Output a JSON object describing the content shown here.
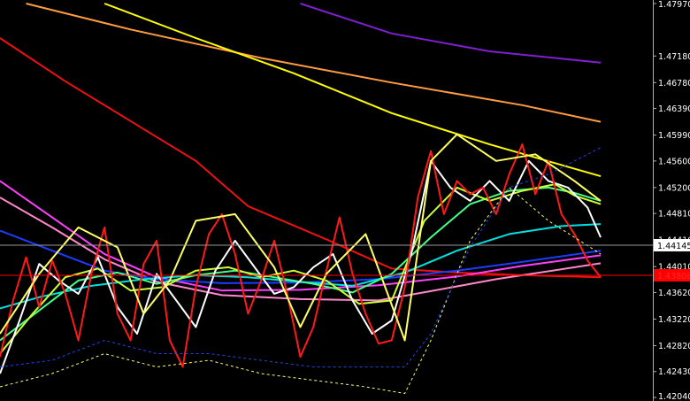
{
  "chart_data": {
    "type": "line",
    "ylim": [
      1.4204,
      1.4797
    ],
    "xlim": [
      0,
      100
    ],
    "grid": false,
    "y_ticks": [
      "1.47970",
      "1.47180",
      "1.46780",
      "1.46390",
      "1.45990",
      "1.45600",
      "1.45200",
      "1.44810",
      "1.44410",
      "1.44010",
      "1.43620",
      "1.43220",
      "1.42820",
      "1.42430",
      "1.42040"
    ],
    "current_price_label": "1.44145",
    "low_price_label": "1.43808",
    "current_price": 1.44145,
    "low_price": 1.43808,
    "colors": {
      "background": "#000000",
      "axis": "#b0b0b0",
      "price_line": "#c0c0c0",
      "low_line": "#ff0000"
    },
    "series": [
      {
        "color": "#7f1fd0",
        "x": [
          46,
          60,
          75,
          92
        ],
        "y": [
          1.4797,
          1.4752,
          1.4725,
          1.4708
        ]
      },
      {
        "color": "#ff9c40",
        "x": [
          4,
          20,
          40,
          60,
          80,
          92
        ],
        "y": [
          1.4797,
          1.4758,
          1.4715,
          1.4678,
          1.4644,
          1.4619
        ]
      },
      {
        "color": "#ffff00",
        "x": [
          16,
          30,
          45,
          60,
          75,
          92
        ],
        "y": [
          1.4797,
          1.4745,
          1.4692,
          1.4632,
          1.4585,
          1.4537
        ]
      },
      {
        "color": "#ee1111",
        "x": [
          0,
          10,
          20,
          30,
          38,
          50,
          60,
          70,
          80,
          92
        ],
        "y": [
          1.4745,
          1.468,
          1.462,
          1.456,
          1.4492,
          1.4442,
          1.4398,
          1.4392,
          1.4388,
          1.4385
        ]
      },
      {
        "color": "#ff40ff",
        "x": [
          0,
          8,
          16,
          24,
          34,
          46,
          58,
          70,
          80,
          92
        ],
        "y": [
          1.453,
          1.4475,
          1.442,
          1.4385,
          1.4365,
          1.4366,
          1.4373,
          1.4386,
          1.4402,
          1.4418
        ]
      },
      {
        "color": "#ff88cc",
        "x": [
          0,
          8,
          16,
          24,
          34,
          46,
          58,
          66,
          76,
          92
        ],
        "y": [
          1.4505,
          1.446,
          1.4412,
          1.4378,
          1.4358,
          1.4352,
          1.435,
          1.4364,
          1.4382,
          1.4406
        ]
      },
      {
        "color": "#1c3cff",
        "x": [
          0,
          8,
          16,
          24,
          34,
          46,
          58,
          70,
          80,
          92
        ],
        "y": [
          1.4455,
          1.4425,
          1.4395,
          1.4382,
          1.4376,
          1.4377,
          1.4382,
          1.4395,
          1.4408,
          1.4425
        ]
      },
      {
        "color": "#00e0e0",
        "x": [
          0,
          6,
          14,
          22,
          30,
          38,
          46,
          54,
          62,
          70,
          78,
          86,
          92
        ],
        "y": [
          1.4338,
          1.4355,
          1.4372,
          1.4382,
          1.4388,
          1.4385,
          1.4378,
          1.4372,
          1.4392,
          1.4425,
          1.445,
          1.4462,
          1.4465
        ]
      },
      {
        "color": "#44ff88",
        "x": [
          0,
          6,
          12,
          18,
          24,
          30,
          36,
          42,
          48,
          54,
          60,
          66,
          72,
          78,
          84,
          88,
          92
        ],
        "y": [
          1.429,
          1.4335,
          1.438,
          1.4392,
          1.4375,
          1.4388,
          1.4395,
          1.4385,
          1.4375,
          1.4362,
          1.439,
          1.4445,
          1.4495,
          1.4515,
          1.452,
          1.4512,
          1.45
        ]
      },
      {
        "color": "#ccff33",
        "x": [
          0,
          5,
          10,
          15,
          20,
          25,
          30,
          35,
          40,
          45,
          50,
          55,
          60,
          65,
          70,
          75,
          80,
          85,
          88,
          92
        ],
        "y": [
          1.427,
          1.433,
          1.4385,
          1.4398,
          1.4365,
          1.437,
          1.4395,
          1.44,
          1.4385,
          1.4395,
          1.438,
          1.4345,
          1.435,
          1.447,
          1.452,
          1.45,
          1.4515,
          1.4525,
          1.4508,
          1.4495
        ]
      },
      {
        "color": "#ffffff",
        "x": [
          0,
          3,
          6,
          9,
          12,
          15,
          18,
          21,
          24,
          27,
          30,
          33,
          36,
          39,
          42,
          45,
          48,
          51,
          54,
          57,
          60,
          63,
          66,
          69,
          72,
          75,
          78,
          81,
          84,
          87,
          90,
          92
        ],
        "y": [
          1.424,
          1.432,
          1.4405,
          1.438,
          1.436,
          1.4415,
          1.434,
          1.43,
          1.439,
          1.435,
          1.431,
          1.4395,
          1.444,
          1.44,
          1.436,
          1.437,
          1.44,
          1.442,
          1.435,
          1.43,
          1.432,
          1.442,
          1.456,
          1.452,
          1.45,
          1.453,
          1.45,
          1.456,
          1.453,
          1.452,
          1.449,
          1.4445
        ]
      },
      {
        "color": "#ff1a1a",
        "x": [
          0,
          2,
          4,
          6,
          8,
          10,
          12,
          14,
          16,
          18,
          20,
          22,
          24,
          26,
          28,
          30,
          32,
          34,
          36,
          38,
          40,
          42,
          44,
          46,
          48,
          50,
          52,
          54,
          56,
          58,
          60,
          62,
          64,
          66,
          68,
          70,
          72,
          74,
          76,
          78,
          80,
          82,
          84,
          86,
          88,
          90,
          92
        ],
        "y": [
          1.4265,
          1.435,
          1.4415,
          1.434,
          1.441,
          1.436,
          1.429,
          1.439,
          1.446,
          1.433,
          1.429,
          1.4405,
          1.444,
          1.429,
          1.425,
          1.437,
          1.445,
          1.448,
          1.442,
          1.433,
          1.438,
          1.444,
          1.436,
          1.4265,
          1.431,
          1.4395,
          1.4475,
          1.439,
          1.433,
          1.4285,
          1.429,
          1.437,
          1.4505,
          1.4575,
          1.448,
          1.453,
          1.451,
          1.452,
          1.448,
          1.454,
          1.4585,
          1.451,
          1.456,
          1.448,
          1.445,
          1.441,
          1.4385
        ]
      },
      {
        "color": "#ffff66",
        "x": [
          0,
          6,
          12,
          18,
          22,
          26,
          30,
          36,
          42,
          46,
          50,
          56,
          62,
          66,
          70,
          76,
          82,
          88,
          92
        ],
        "y": [
          1.43,
          1.439,
          1.446,
          1.443,
          1.433,
          1.438,
          1.447,
          1.448,
          1.44,
          1.431,
          1.439,
          1.445,
          1.429,
          1.456,
          1.46,
          1.456,
          1.457,
          1.453,
          1.45
        ]
      },
      {
        "color": "#ffff66",
        "dash": "3,3",
        "x": [
          0,
          8,
          16,
          24,
          32,
          40,
          48,
          56,
          62,
          66,
          72,
          78,
          84,
          92
        ],
        "y": [
          1.422,
          1.424,
          1.427,
          1.425,
          1.426,
          1.424,
          1.423,
          1.422,
          1.421,
          1.429,
          1.444,
          1.452,
          1.447,
          1.442
        ]
      },
      {
        "color": "#2244ee",
        "dash": "3,3",
        "x": [
          0,
          8,
          16,
          24,
          32,
          40,
          48,
          56,
          62,
          66,
          72,
          78,
          84,
          92
        ],
        "y": [
          1.425,
          1.426,
          1.429,
          1.427,
          1.427,
          1.426,
          1.425,
          1.425,
          1.425,
          1.43,
          1.443,
          1.452,
          1.454,
          1.458
        ]
      }
    ]
  }
}
